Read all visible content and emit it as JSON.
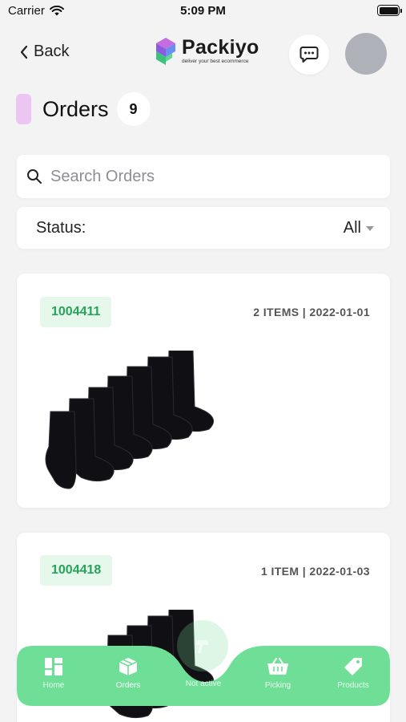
{
  "status_bar": {
    "carrier": "Carrier",
    "time": "5:09 PM"
  },
  "nav": {
    "back_label": "Back",
    "logo_name": "Packiyo",
    "logo_tagline": "deliver your best ecommerce"
  },
  "page": {
    "title": "Orders",
    "count": "9"
  },
  "search": {
    "placeholder": "Search Orders",
    "value": ""
  },
  "filter": {
    "label": "Status:",
    "value": "All"
  },
  "orders": [
    {
      "id": "1004411",
      "meta": "2 ITEMS | 2022-01-01"
    },
    {
      "id": "1004418",
      "meta": "1 ITEM | 2022-01-03"
    }
  ],
  "tabbar": {
    "tabs": [
      {
        "label": "Home",
        "icon": "grid-icon"
      },
      {
        "label": "Orders",
        "icon": "box-icon"
      },
      {
        "label": "Not active",
        "icon": "scanner-icon"
      },
      {
        "label": "Picking",
        "icon": "basket-icon"
      },
      {
        "label": "Products",
        "icon": "tag-icon"
      }
    ],
    "active": "Orders"
  },
  "colors": {
    "tab_green": "#6fdf97",
    "accent_green": "#27a35a",
    "title_accent": "#ecc6f2",
    "badge_bg": "#e6f7ec"
  }
}
